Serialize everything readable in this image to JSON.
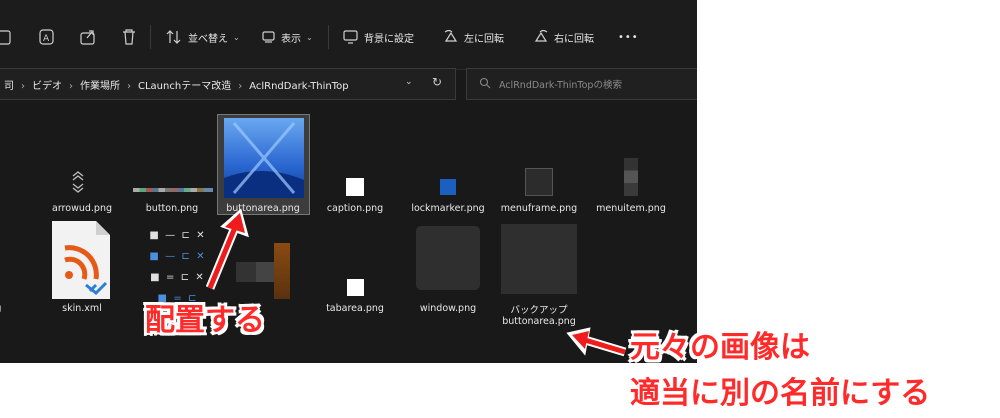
{
  "toolbar": {
    "sort_label": "並べ替え",
    "view_label": "表示",
    "set_background_label": "背景に設定",
    "rotate_left_label": "左に回転",
    "rotate_right_label": "右に回転",
    "more_label": "•••"
  },
  "address_bar": {
    "crumbs": [
      "司",
      "ビデオ",
      "作業場所",
      "CLaunchテーマ改造",
      "AclRndDark-ThinTop"
    ],
    "dropdown_glyph": "⌄",
    "refresh_glyph": "↻"
  },
  "search": {
    "placeholder": "AclRndDark-ThinTopの検索"
  },
  "files_row1": [
    {
      "name": "png",
      "icon": "partial-icon"
    },
    {
      "name": "arrowud.png",
      "icon": "arrows-icon"
    },
    {
      "name": "button.png",
      "icon": "strip-icon"
    },
    {
      "name": "buttonarea.png",
      "icon": "blue-image-thumbnail"
    },
    {
      "name": "caption.png",
      "icon": "white-square-thumbnail"
    },
    {
      "name": "lockmarker.png",
      "icon": "blue-square-thumbnail"
    },
    {
      "name": "menuframe.png",
      "icon": "dark-square-thumbnail"
    },
    {
      "name": "menuitem.png",
      "icon": "gray-strip-thumbnail"
    }
  ],
  "files_row2": [
    {
      "name": "on.png",
      "icon": "partial-icon"
    },
    {
      "name": "skin.xml",
      "icon": "rss-file-icon"
    },
    {
      "name": "",
      "icon": "window-controls-thumbnail"
    },
    {
      "name": "",
      "icon": "brown-blocks-thumbnail"
    },
    {
      "name": "tabarea.png",
      "icon": "white-square-thumbnail"
    },
    {
      "name": "window.png",
      "icon": "dark-large-thumbnail"
    },
    {
      "name": "バックアップ buttonarea.png",
      "line1": "バックアップ",
      "line2": "buttonarea.png",
      "icon": "dark-large-thumbnail"
    }
  ],
  "annotations": {
    "place": "配置する",
    "rename_line1": "元々の画像は",
    "rename_line2": "適当に別の名前にする"
  },
  "colors": {
    "annotation": "#ff2b2b",
    "window_bg": "#191919",
    "selection": "#3d3d3d"
  }
}
